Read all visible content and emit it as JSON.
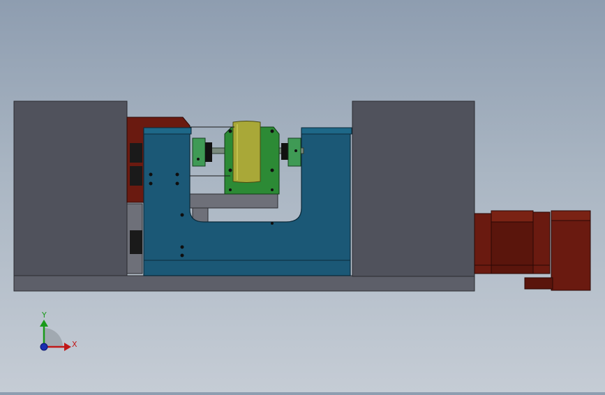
{
  "colors": {
    "background_top": "#8e9db0",
    "background_bottom": "#c5ccd5",
    "block_gray": "#50525c",
    "base_plate": "#5d5f69",
    "frame_blue": "#1b5876",
    "frame_blue_dark": "#134660",
    "bracket_green": "#2c8a35",
    "coupling_green": "#3f9a55",
    "roller_yellow": "#a9a838",
    "motor_red": "#6a1a10",
    "motor_red_dark": "#4a0f08",
    "axis_x": "#c01818",
    "axis_y": "#1a9a1a",
    "axis_z": "#1a2fb0"
  },
  "triad": {
    "x_label": "X",
    "y_label": "Y"
  }
}
